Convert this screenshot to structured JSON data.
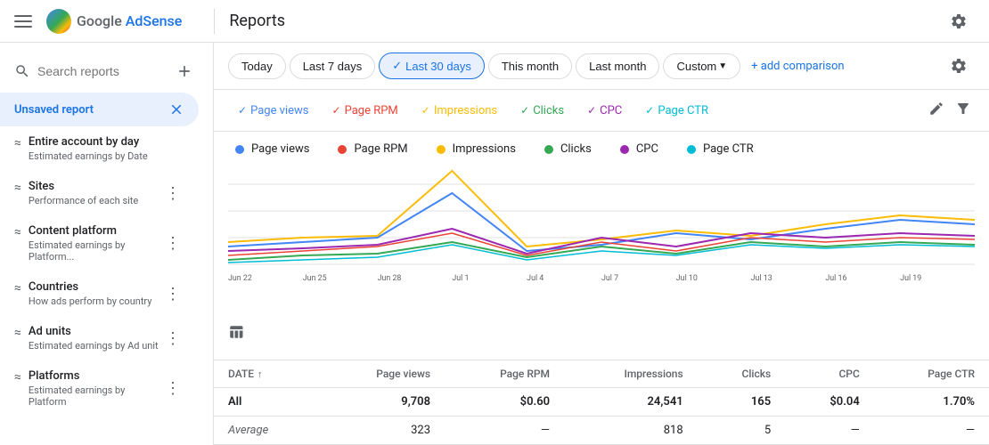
{
  "navbar": {
    "page_title": "Reports",
    "logo_text_google": "Google ",
    "logo_text_adsense": "AdSense"
  },
  "filter_bar": {
    "today": "Today",
    "last_7_days": "Last 7 days",
    "last_30_days": "Last 30 days",
    "this_month": "This month",
    "last_month": "Last month",
    "custom": "Custom",
    "add_comparison": "+ add comparison"
  },
  "metric_tabs": [
    {
      "label": "Page views",
      "color": "#4285f4",
      "checked": true
    },
    {
      "label": "Page RPM",
      "color": "#ea4335",
      "checked": true
    },
    {
      "label": "Impressions",
      "color": "#fbbc05",
      "checked": true
    },
    {
      "label": "Clicks",
      "color": "#34a853",
      "checked": true
    },
    {
      "label": "CPC",
      "color": "#9c27b0",
      "checked": true
    },
    {
      "label": "Page CTR",
      "color": "#00bcd4",
      "checked": true
    }
  ],
  "chart_legend": [
    {
      "label": "Page views",
      "color": "#4285f4"
    },
    {
      "label": "Page RPM",
      "color": "#ea4335"
    },
    {
      "label": "Impressions",
      "color": "#fbbc05"
    },
    {
      "label": "Clicks",
      "color": "#34a853"
    },
    {
      "label": "CPC",
      "color": "#9c27b0"
    },
    {
      "label": "Page CTR",
      "color": "#00bcd4"
    }
  ],
  "chart_x_labels": [
    "Jun 22",
    "Jun 25",
    "Jun 28",
    "Jul 1",
    "Jul 4",
    "Jul 7",
    "Jul 10",
    "Jul 13",
    "Jul 16",
    "Jul 19"
  ],
  "table": {
    "headers": [
      "DATE",
      "Page views",
      "Page RPM",
      "Impressions",
      "Clicks",
      "CPC",
      "Page CTR"
    ],
    "rows": [
      {
        "date": "All",
        "page_views": "9,708",
        "page_rpm": "$0.60",
        "impressions": "24,541",
        "clicks": "165",
        "cpc": "$0.04",
        "page_ctr": "1.70%"
      },
      {
        "date": "Average",
        "page_views": "323",
        "page_rpm": "—",
        "impressions": "818",
        "clicks": "5",
        "cpc": "—",
        "page_ctr": "—"
      }
    ]
  },
  "sidebar": {
    "search_placeholder": "Search reports",
    "unsaved_report": "Unsaved report",
    "reports": [
      {
        "name": "Entire account by day",
        "desc": "Estimated earnings by Date"
      },
      {
        "name": "Sites",
        "desc": "Performance of each site"
      },
      {
        "name": "Content platform",
        "desc": "Estimated earnings by Platform..."
      },
      {
        "name": "Countries",
        "desc": "How ads perform by country"
      },
      {
        "name": "Ad units",
        "desc": "Estimated earnings by Ad unit"
      },
      {
        "name": "Platforms",
        "desc": "Estimated earnings by Platform"
      }
    ]
  }
}
